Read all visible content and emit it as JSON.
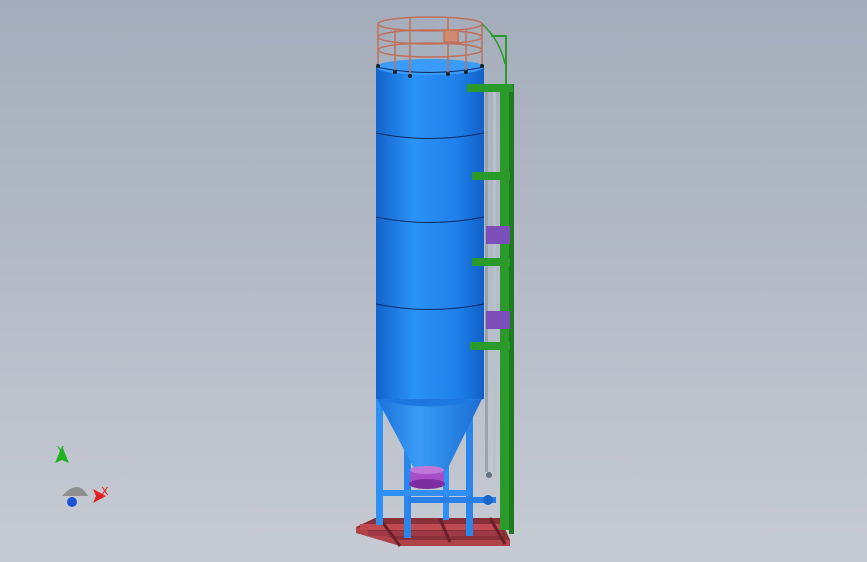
{
  "viewport": {
    "background_top": "#a4adbb",
    "background_bottom": "#c6cbd3"
  },
  "model": {
    "silo_color": "#1f86ee",
    "cone_color": "#2a8cf0",
    "frame_color": "#2f8ff2",
    "base_color": "#b0424a",
    "ladder_frame_color": "#2a9a2a",
    "brace_color": "#7c4fb8",
    "railing_color": "#c0705a"
  },
  "triad": {
    "x_label": "X",
    "y_label": "Y",
    "x_color": "#e22020",
    "y_color": "#22b222",
    "z_color": "#2050d8"
  }
}
